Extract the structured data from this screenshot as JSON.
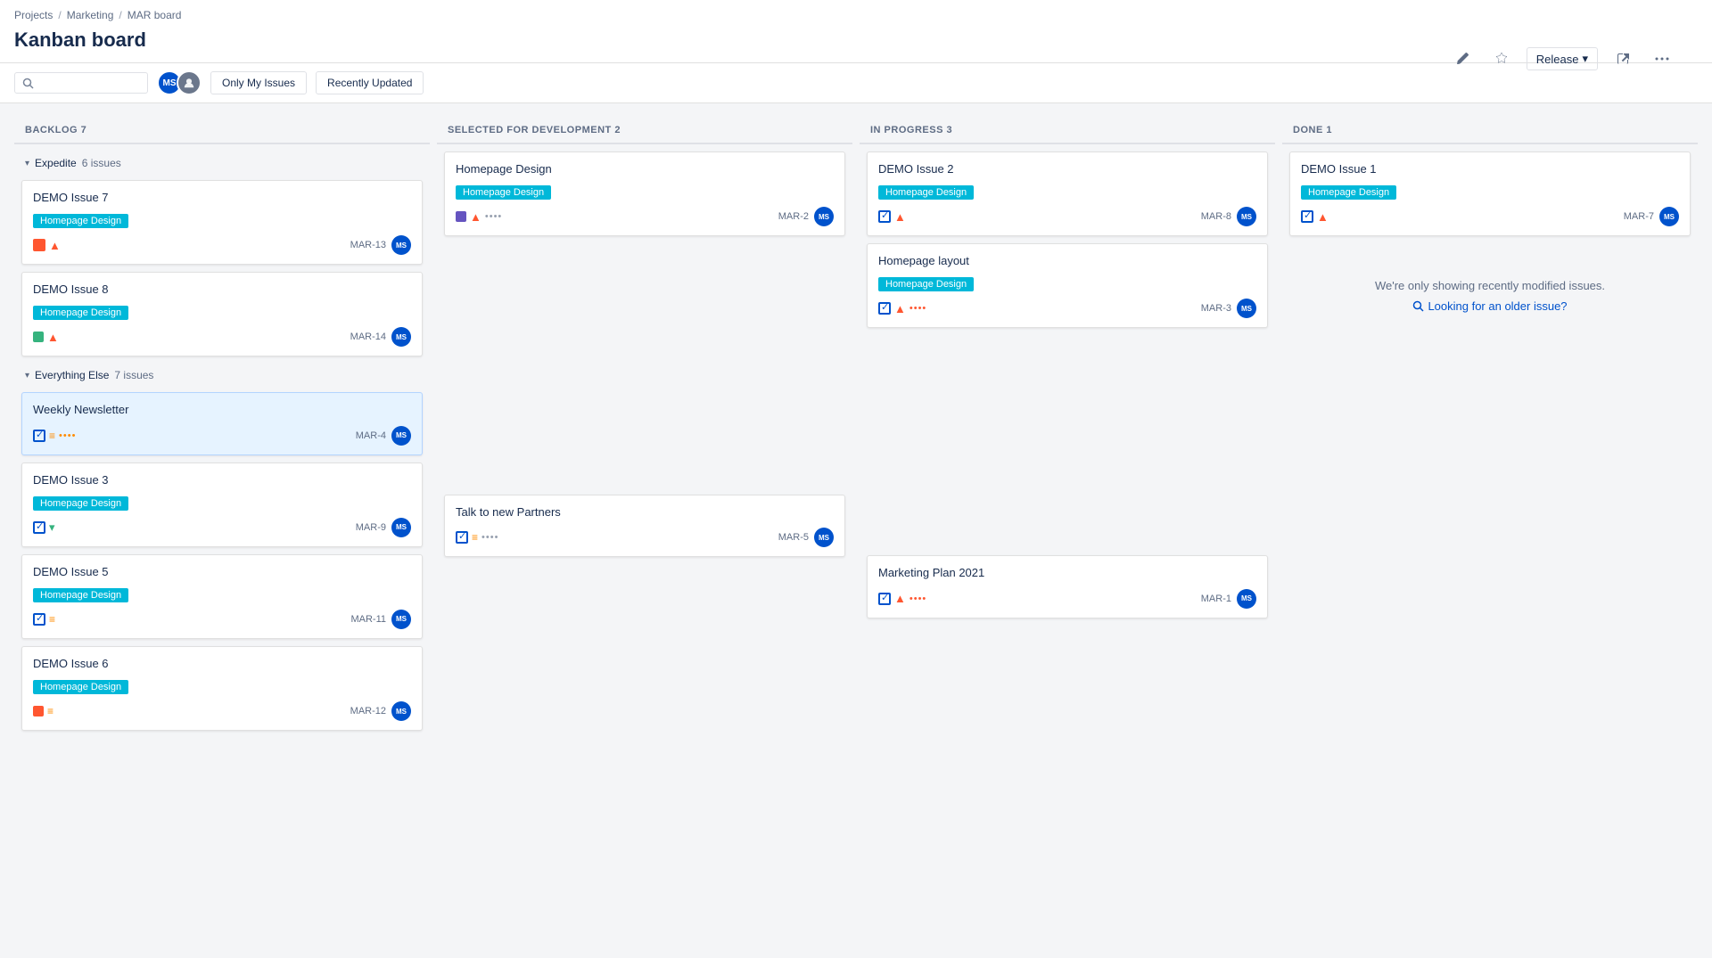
{
  "breadcrumb": {
    "items": [
      "Projects",
      "Marketing",
      "MAR board"
    ]
  },
  "page": {
    "title": "Kanban board"
  },
  "header": {
    "release_label": "Release",
    "pencil_icon": "✏",
    "star_icon": "☆",
    "share_icon": "↗",
    "more_icon": "•••"
  },
  "toolbar": {
    "search_placeholder": "",
    "filter1": "Only My Issues",
    "filter2": "Recently Updated"
  },
  "columns": [
    {
      "id": "backlog",
      "title": "BACKLOG",
      "count": 7,
      "groups": [
        {
          "name": "Expedite",
          "count": 6,
          "issues_label": "issues",
          "cards": [
            {
              "title": "DEMO Issue 7",
              "tag": "Homepage Design",
              "icon_type": "fire",
              "priority": "high",
              "date": "MAR-13",
              "has_more": false
            },
            {
              "title": "DEMO Issue 8",
              "tag": "Homepage Design",
              "icon_type": "story",
              "priority": "high",
              "date": "MAR-14",
              "has_more": false
            }
          ]
        },
        {
          "name": "Everything Else",
          "count": 7,
          "issues_label": "issues",
          "cards": [
            {
              "title": "Weekly Newsletter",
              "tag": null,
              "icon_type": "check",
              "priority": "medium",
              "date": "MAR-4",
              "has_more": true,
              "selected": true
            },
            {
              "title": "DEMO Issue 3",
              "tag": "Homepage Design",
              "icon_type": "check",
              "priority": "low",
              "date": "MAR-9",
              "has_more": false
            },
            {
              "title": "DEMO Issue 5",
              "tag": "Homepage Design",
              "icon_type": "check",
              "priority": "medium",
              "date": "MAR-11",
              "has_more": false
            },
            {
              "title": "DEMO Issue 6",
              "tag": "Homepage Design",
              "icon_type": "fire_red",
              "priority": "medium",
              "date": "MAR-12",
              "has_more": false
            }
          ]
        }
      ]
    },
    {
      "id": "selected",
      "title": "SELECTED FOR DEVELOPMENT",
      "count": 2,
      "groups": [
        {
          "name": null,
          "cards": [
            {
              "title": "Homepage Design",
              "tag": "Homepage Design",
              "icon_type": "story_purple",
              "priority": "high",
              "date": "MAR-2",
              "has_more": true
            }
          ]
        },
        {
          "name": null,
          "cards": [
            {
              "title": "Talk to new Partners",
              "tag": null,
              "icon_type": "check",
              "priority": "medium",
              "date": "MAR-5",
              "has_more": true
            }
          ]
        }
      ]
    },
    {
      "id": "inprogress",
      "title": "IN PROGRESS",
      "count": 3,
      "groups": [
        {
          "name": null,
          "cards": [
            {
              "title": "DEMO Issue 2",
              "tag": "Homepage Design",
              "icon_type": "check",
              "priority": "high",
              "date": "MAR-8",
              "has_more": false
            },
            {
              "title": "Homepage layout",
              "tag": "Homepage Design",
              "icon_type": "check",
              "priority": "high",
              "date": "MAR-3",
              "has_more": true
            }
          ]
        },
        {
          "name": null,
          "cards": [
            {
              "title": "Marketing Plan 2021",
              "tag": null,
              "icon_type": "check",
              "priority": "high",
              "date": "MAR-1",
              "has_more": true
            }
          ]
        }
      ]
    },
    {
      "id": "done",
      "title": "DONE",
      "count": 1,
      "groups": [
        {
          "name": null,
          "cards": [
            {
              "title": "DEMO Issue 1",
              "tag": "Homepage Design",
              "icon_type": "check",
              "priority": "high",
              "date": "MAR-7",
              "has_more": false
            }
          ]
        }
      ]
    }
  ],
  "done_message": {
    "text": "We're only showing recently modified issues.",
    "link": "Looking for an older issue?"
  }
}
